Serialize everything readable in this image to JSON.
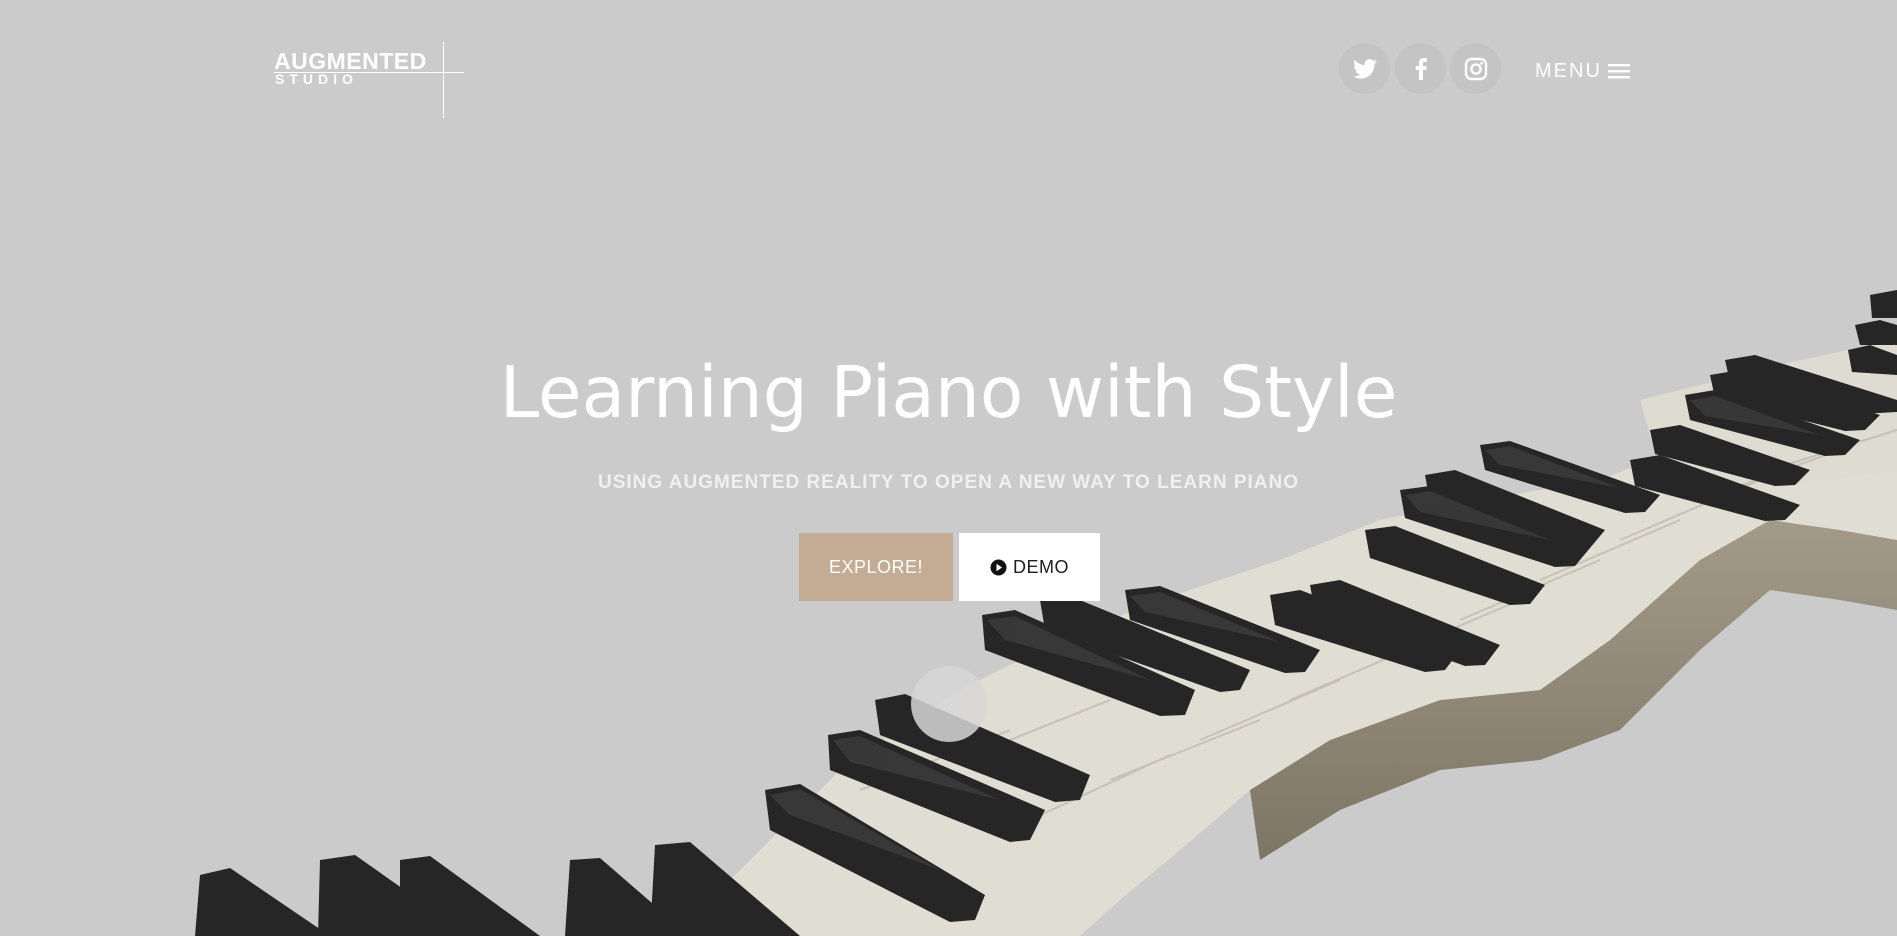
{
  "brand": {
    "name_main": "AUGMENTED",
    "name_sub": "STUDIO"
  },
  "header": {
    "social": [
      {
        "name": "twitter",
        "icon": "twitter-icon"
      },
      {
        "name": "facebook",
        "icon": "facebook-icon"
      },
      {
        "name": "instagram",
        "icon": "instagram-icon"
      }
    ],
    "menu_label": "MENU",
    "menu_icon": "hamburger-icon"
  },
  "hero": {
    "title": "Learning Piano with Style",
    "subtitle": "USING AUGMENTED REALITY TO OPEN A NEW WAY TO LEARN PIANO",
    "explore_label": "EXPLORE!",
    "demo_label": "DEMO",
    "demo_icon": "play-circle-icon",
    "scroll_icon": "scroll-down-circle"
  },
  "colors": {
    "background": "#cbcbcb",
    "explore_button": "#c4ac94",
    "demo_button": "#ffffff",
    "text": "#ffffff",
    "black_key": "#262626",
    "white_key": "#e2e0d4"
  }
}
